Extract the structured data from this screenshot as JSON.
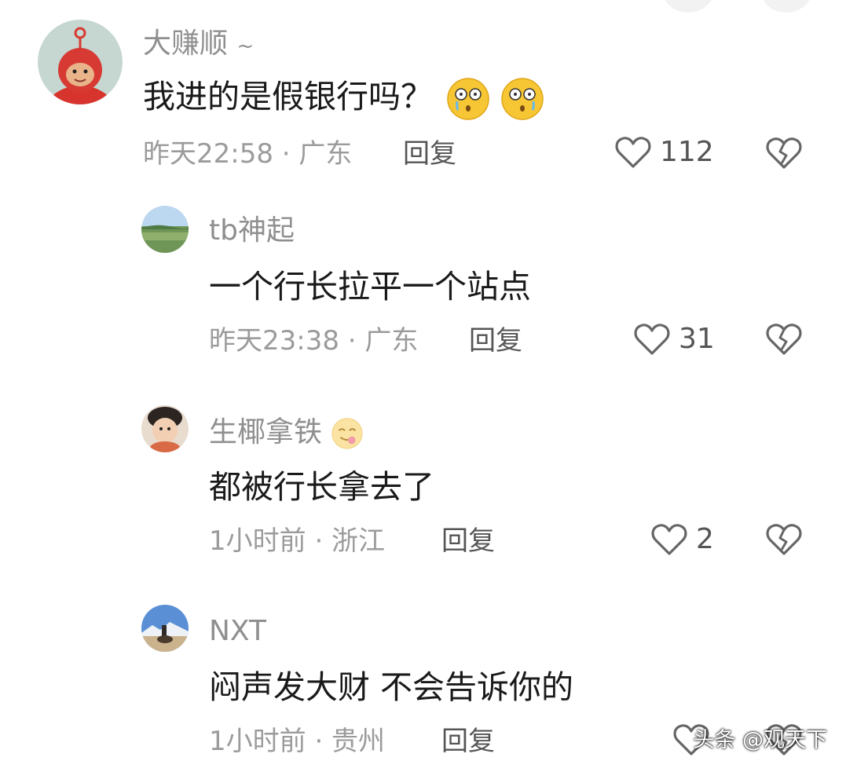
{
  "comments": [
    {
      "user": "大赚顺",
      "user_suffix": "~",
      "text": "我进的是假银行吗？",
      "emoji": [
        "dizzy-cry-emoji",
        "dizzy-cry-emoji"
      ],
      "time": "昨天22:58 · 广东",
      "reply_label": "回复",
      "likes": "112"
    },
    {
      "user": "tb神起",
      "text": "一个行长拉平一个站点",
      "time": "昨天23:38 · 广东",
      "reply_label": "回复",
      "likes": "31"
    },
    {
      "user": "生椰拿铁",
      "user_emoji": "tongue-smile-emoji",
      "text": "都被行长拿去了",
      "time": "1小时前 · 浙江",
      "reply_label": "回复",
      "likes": "2"
    },
    {
      "user": "NXT",
      "text": "闷声发大财 不会告诉你的",
      "time": "1小时前 · 贵州",
      "reply_label": "回复",
      "likes": ""
    }
  ],
  "watermark": "头条 @观天下",
  "colors": {
    "name": "#8f8f8f",
    "text": "#1a1a1a",
    "meta": "#9b9b9b",
    "reply": "#555555",
    "icon": "#666666"
  }
}
